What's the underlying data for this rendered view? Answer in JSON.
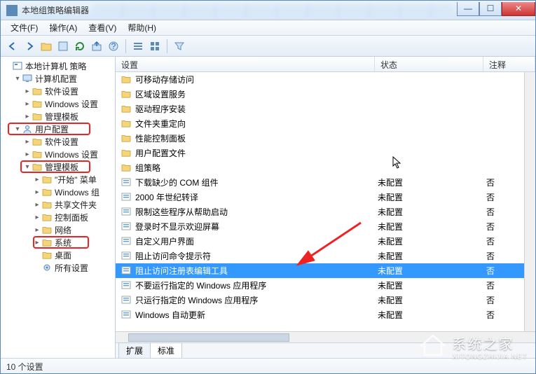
{
  "window": {
    "title": "本地组策略编辑器",
    "btn_min": "—",
    "btn_max": "☐",
    "btn_close": "✕"
  },
  "menu": [
    "文件(F)",
    "操作(A)",
    "查看(V)",
    "帮助(H)"
  ],
  "toolbar_icons": [
    "back",
    "forward",
    "up",
    "props",
    "refresh",
    "export",
    "help",
    "sep",
    "list",
    "detail",
    "sep",
    "filter"
  ],
  "tree": [
    {
      "d": 0,
      "tw": "",
      "icon": "policy",
      "label": "本地计算机 策略"
    },
    {
      "d": 1,
      "tw": "▾",
      "icon": "computer",
      "label": "计算机配置"
    },
    {
      "d": 2,
      "tw": "▸",
      "icon": "folder",
      "label": "软件设置"
    },
    {
      "d": 2,
      "tw": "▸",
      "icon": "folder",
      "label": "Windows 设置"
    },
    {
      "d": 2,
      "tw": "▸",
      "icon": "folder",
      "label": "管理模板"
    },
    {
      "d": 1,
      "tw": "▾",
      "icon": "user",
      "label": "用户配置"
    },
    {
      "d": 2,
      "tw": "▸",
      "icon": "folder",
      "label": "软件设置"
    },
    {
      "d": 2,
      "tw": "▸",
      "icon": "folder",
      "label": "Windows 设置"
    },
    {
      "d": 2,
      "tw": "▾",
      "icon": "folder",
      "label": "管理模板"
    },
    {
      "d": 3,
      "tw": "▸",
      "icon": "folder",
      "label": "\"开始\" 菜单"
    },
    {
      "d": 3,
      "tw": "▸",
      "icon": "folder",
      "label": "Windows 组"
    },
    {
      "d": 3,
      "tw": "▸",
      "icon": "folder",
      "label": "共享文件夹"
    },
    {
      "d": 3,
      "tw": "▸",
      "icon": "folder",
      "label": "控制面板"
    },
    {
      "d": 3,
      "tw": "▸",
      "icon": "folder",
      "label": "网络"
    },
    {
      "d": 3,
      "tw": "▸",
      "icon": "folder",
      "label": "系统"
    },
    {
      "d": 3,
      "tw": "",
      "icon": "folder",
      "label": "桌面"
    },
    {
      "d": 3,
      "tw": "",
      "icon": "gear",
      "label": "所有设置"
    }
  ],
  "columns": {
    "name": "设置",
    "state": "状态",
    "note": "注释"
  },
  "rows": [
    {
      "icon": "folder",
      "name": "可移动存储访问",
      "state": "",
      "note": ""
    },
    {
      "icon": "folder",
      "name": "区域设置服务",
      "state": "",
      "note": ""
    },
    {
      "icon": "folder",
      "name": "驱动程序安装",
      "state": "",
      "note": ""
    },
    {
      "icon": "folder",
      "name": "文件夹重定向",
      "state": "",
      "note": ""
    },
    {
      "icon": "folder",
      "name": "性能控制面板",
      "state": "",
      "note": ""
    },
    {
      "icon": "folder",
      "name": "用户配置文件",
      "state": "",
      "note": ""
    },
    {
      "icon": "folder",
      "name": "组策略",
      "state": "",
      "note": ""
    },
    {
      "icon": "setting",
      "name": "下载缺少的 COM 组件",
      "state": "未配置",
      "note": "否"
    },
    {
      "icon": "setting",
      "name": "2000 年世纪转译",
      "state": "未配置",
      "note": "否"
    },
    {
      "icon": "setting",
      "name": "限制这些程序从帮助启动",
      "state": "未配置",
      "note": "否"
    },
    {
      "icon": "setting",
      "name": "登录时不显示欢迎屏幕",
      "state": "未配置",
      "note": "否"
    },
    {
      "icon": "setting",
      "name": "自定义用户界面",
      "state": "未配置",
      "note": "否"
    },
    {
      "icon": "setting",
      "name": "阻止访问命令提示符",
      "state": "未配置",
      "note": "否"
    },
    {
      "icon": "setting",
      "name": "阻止访问注册表编辑工具",
      "state": "未配置",
      "note": "否",
      "sel": true
    },
    {
      "icon": "setting",
      "name": "不要运行指定的 Windows 应用程序",
      "state": "未配置",
      "note": "否"
    },
    {
      "icon": "setting",
      "name": "只运行指定的 Windows 应用程序",
      "state": "未配置",
      "note": "否"
    },
    {
      "icon": "setting",
      "name": "Windows 自动更新",
      "state": "未配置",
      "note": "否"
    }
  ],
  "tabs": {
    "extended": "扩展",
    "standard": "标准"
  },
  "status": "10 个设置",
  "watermark": {
    "title": "系统之家",
    "sub": "XITONGZHIJIA.NET"
  }
}
